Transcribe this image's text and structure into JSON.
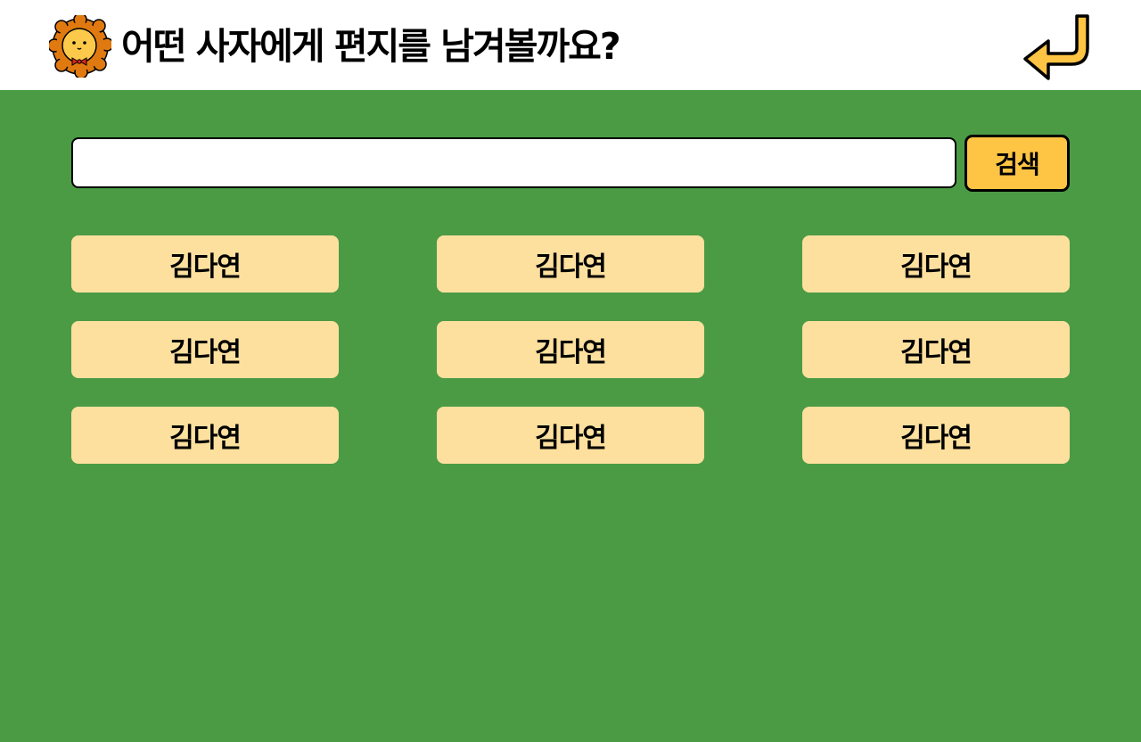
{
  "header": {
    "title": "어떤 사자에게 편지를 남겨볼까요?",
    "logo_icon": "lion-icon",
    "back_icon": "return-arrow-icon"
  },
  "search": {
    "value": "",
    "placeholder": "",
    "button_label": "검색"
  },
  "lions": [
    {
      "name": "김다연"
    },
    {
      "name": "김다연"
    },
    {
      "name": "김다연"
    },
    {
      "name": "김다연"
    },
    {
      "name": "김다연"
    },
    {
      "name": "김다연"
    },
    {
      "name": "김다연"
    },
    {
      "name": "김다연"
    },
    {
      "name": "김다연"
    }
  ],
  "colors": {
    "background": "#4b9b45",
    "header": "#ffffff",
    "button_fill": "#fee09e",
    "search_button": "#fec444"
  }
}
